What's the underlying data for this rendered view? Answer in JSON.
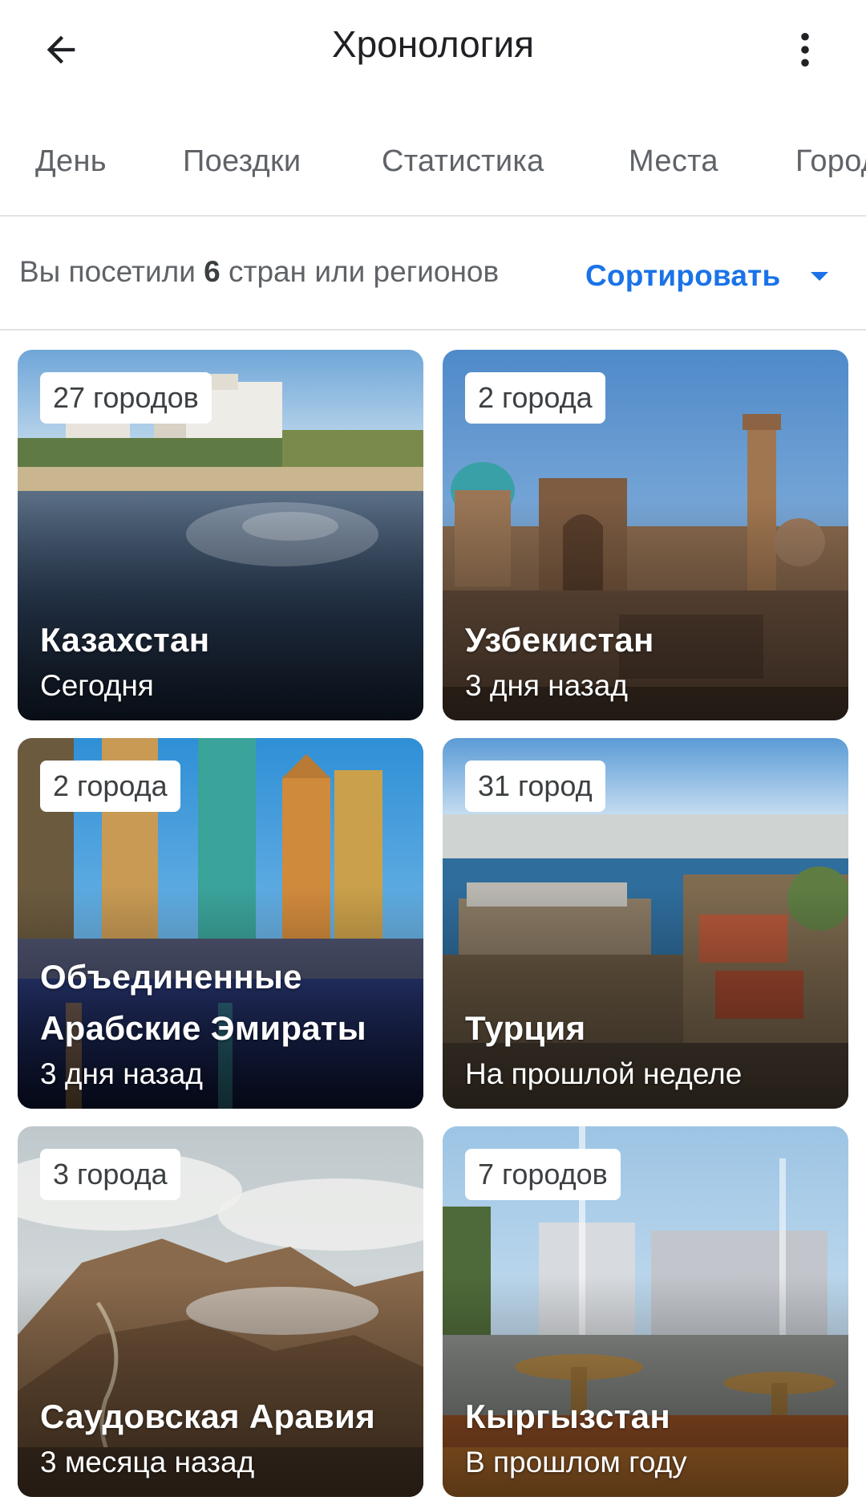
{
  "header": {
    "title": "Хронология"
  },
  "tabs": [
    {
      "label": "День"
    },
    {
      "label": "Поездки"
    },
    {
      "label": "Статистика"
    },
    {
      "label": "Места"
    },
    {
      "label": "Города"
    }
  ],
  "summary": {
    "prefix": "Вы посетили",
    "count": "6",
    "suffix": "стран или регионов",
    "sort_label": "Сортировать"
  },
  "countries": [
    {
      "badge": "27 городов",
      "name": "Казахстан",
      "date": "Сегодня"
    },
    {
      "badge": "2 города",
      "name": "Узбекистан",
      "date": "3 дня назад"
    },
    {
      "badge": "2 города",
      "name": "Объединенные Арабские Эмираты",
      "date": "3 дня назад"
    },
    {
      "badge": "31 город",
      "name": "Турция",
      "date": "На прошлой неделе"
    },
    {
      "badge": "3 города",
      "name": "Саудовская Аравия",
      "date": "3 месяца назад"
    },
    {
      "badge": "7 городов",
      "name": "Кыргызстан",
      "date": "В прошлом году"
    }
  ],
  "colors": {
    "accent": "#1a73e8",
    "text_secondary": "#5f6368"
  },
  "icons": {
    "back": "arrow-left",
    "more": "more-vert",
    "sort": "caret-down"
  }
}
